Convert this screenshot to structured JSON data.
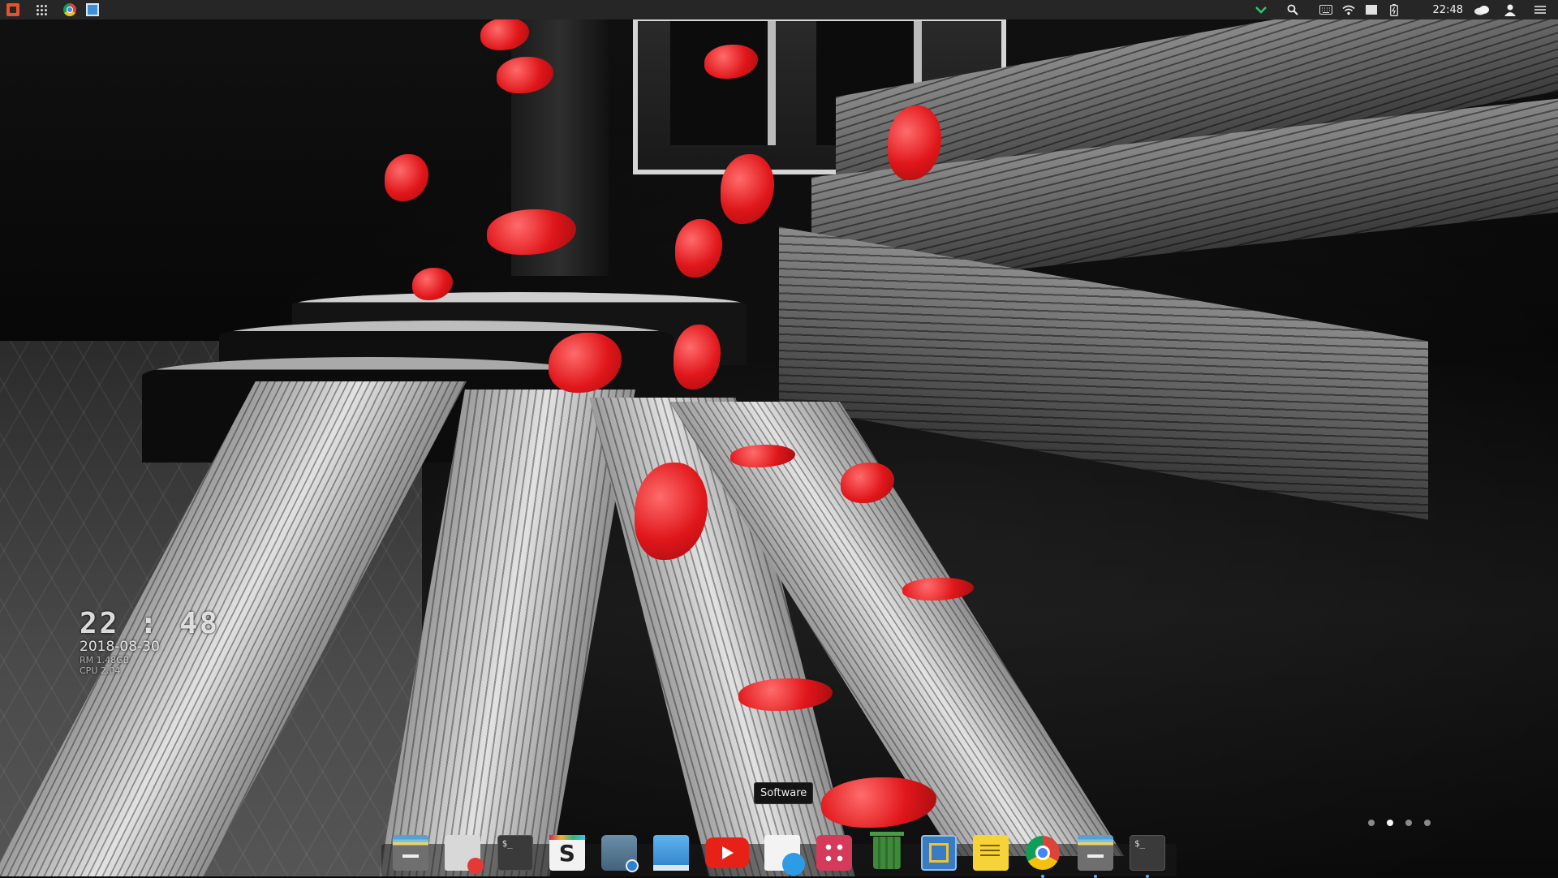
{
  "top_panel": {
    "left_icons": [
      "launcher-icon",
      "app-grid-icon",
      "chrome-icon",
      "window-manager-icon"
    ],
    "right_icons": [
      "chevron-down-icon",
      "search-icon",
      "keyboard-icon",
      "wifi-icon",
      "display-icon",
      "battery-icon",
      "weather-icon",
      "user-icon",
      "menu-icon"
    ],
    "clock": "22:48"
  },
  "desktop_widget": {
    "time": "22 : 48",
    "date": "2018-08-30",
    "ram_line": "RM 1.48GB",
    "cpu_line": "CPU 2.04"
  },
  "tooltip": {
    "text": "Software"
  },
  "pager": {
    "pages": 4,
    "active_index": 1
  },
  "dock": {
    "items": [
      {
        "name": "files-icon",
        "running": false
      },
      {
        "name": "text-editor-icon",
        "running": false
      },
      {
        "name": "terminal-icon",
        "running": false,
        "glyph": "$_"
      },
      {
        "name": "slack-icon",
        "running": false,
        "glyph": "S"
      },
      {
        "name": "screenshot-icon",
        "running": false
      },
      {
        "name": "show-desktop-icon",
        "running": false
      },
      {
        "name": "youtube-icon",
        "running": false
      },
      {
        "name": "software-icon",
        "running": false
      },
      {
        "name": "dots-app-icon",
        "running": false
      },
      {
        "name": "trash-icon",
        "running": false
      },
      {
        "name": "system-monitor-icon",
        "running": false
      },
      {
        "name": "notes-icon",
        "running": false
      },
      {
        "name": "chrome-icon",
        "running": true
      },
      {
        "name": "files-icon",
        "running": true
      },
      {
        "name": "terminal-icon",
        "running": true,
        "glyph": "$_"
      }
    ]
  },
  "colors": {
    "panel": "#262626",
    "accent_green": "#2ecc71",
    "petal_red": "#e0161a"
  }
}
